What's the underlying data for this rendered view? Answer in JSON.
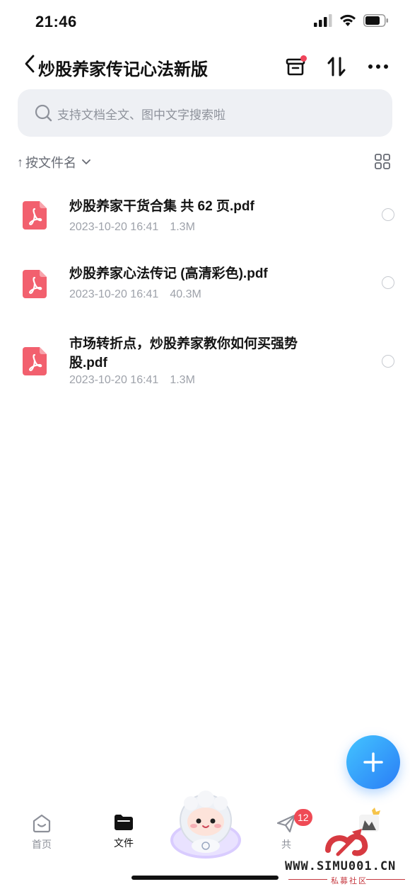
{
  "status_bar": {
    "time": "21:46"
  },
  "nav": {
    "title": "炒股养家传记心法新版",
    "back_icon": "chevron-left-icon",
    "actions": [
      "recycle-box-icon",
      "sort-arrows-icon",
      "more-dots-icon"
    ],
    "notification_dot_color": "#f0445a"
  },
  "search": {
    "placeholder": "支持文档全文、图中文字搜索啦"
  },
  "sort": {
    "label": "按文件名",
    "arrow": "↑"
  },
  "files": [
    {
      "name": "炒股养家干货合集  共 62 页.pdf",
      "date": "2023-10-20 16:41",
      "size": "1.3M"
    },
    {
      "name": "炒股养家心法传记 (高清彩色).pdf",
      "date": "2023-10-20 16:41",
      "size": "40.3M"
    },
    {
      "name": "市场转折点，炒股养家教你如何买强势股.pdf",
      "date": "2023-10-20 16:41",
      "size": "1.3M"
    }
  ],
  "tabs": [
    {
      "label": "首页",
      "active": false
    },
    {
      "label": "文件",
      "active": true
    },
    {
      "label": "共",
      "active": false,
      "badge": "12"
    }
  ],
  "watermark": {
    "url": "WWW.SIMU001.CN",
    "sub": "私募社区"
  },
  "colors": {
    "accent": "#2a7df6",
    "pdf_red": "#f2606e",
    "badge": "#ef4a55"
  }
}
